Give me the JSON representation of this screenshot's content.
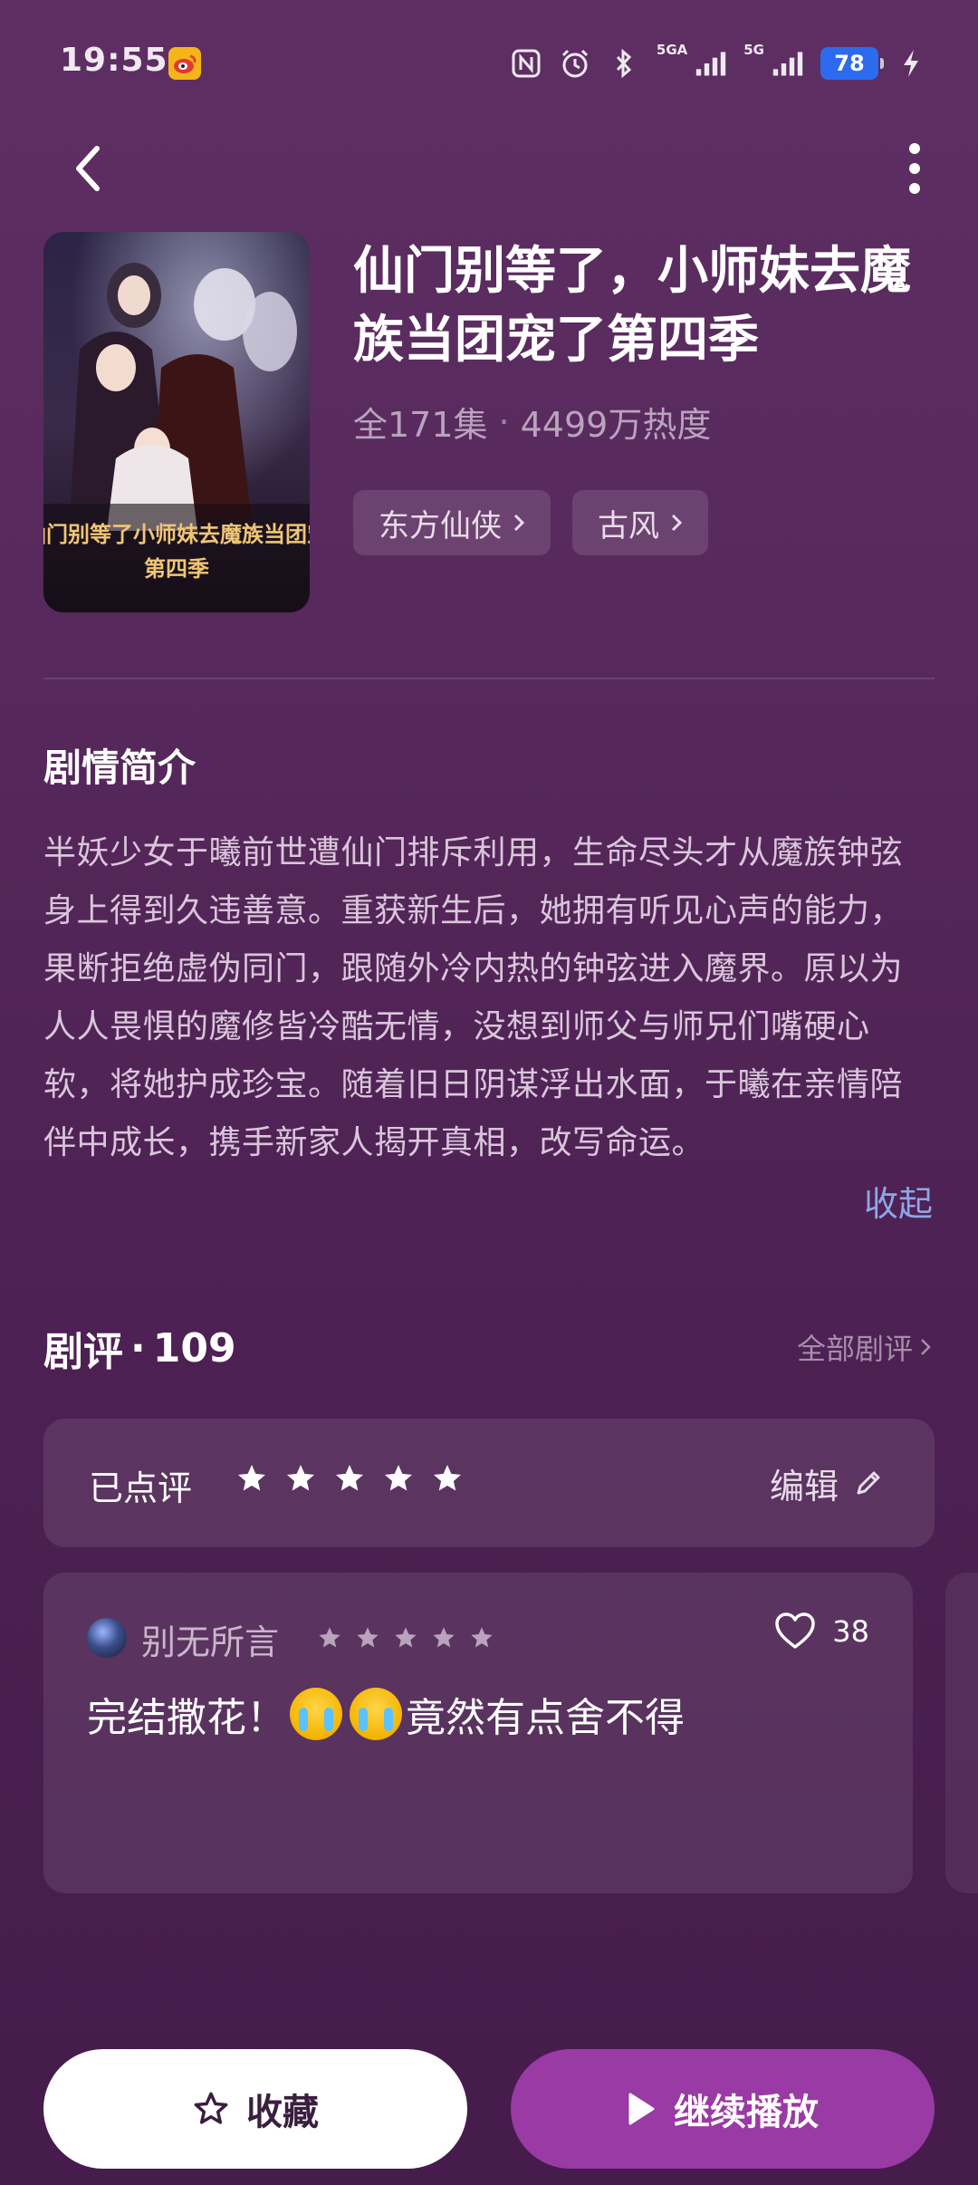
{
  "status_bar": {
    "time": "19:55",
    "network_label": "5GA",
    "network_label_2": "5G",
    "battery": "78"
  },
  "drama": {
    "title": "仙门别等了，小师妹去魔族当团宠了第四季",
    "episodes": "全171集",
    "heat": "4499万热度",
    "tags": [
      "东方仙侠",
      "古风"
    ],
    "cover_title": "仙门别等了小师妹去魔族当团宠",
    "cover_subtitle": "第四季"
  },
  "synopsis": {
    "heading": "剧情简介",
    "text": "半妖少女于曦前世遭仙门排斥利用，生命尽头才从魔族钟弦身上得到久违善意。重获新生后，她拥有听见心声的能力，果断拒绝虚伪同门，跟随外冷内热的钟弦进入魔界。原以为人人畏惧的魔修皆冷酷无情，没想到师父与师兄们嘴硬心软，将她护成珍宝。随着旧日阴谋浮出水面，于曦在亲情陪伴中成长，携手新家人揭开真相，改写命运。",
    "collapse_label": "收起"
  },
  "reviews": {
    "heading": "剧评",
    "separator": "·",
    "count": "109",
    "all_label": "全部剧评",
    "my_rating": {
      "label": "已点评",
      "stars": 5,
      "edit_label": "编辑"
    },
    "items": [
      {
        "user": "别无所言",
        "stars": 5,
        "likes": "38",
        "text_before": "完结撒花！",
        "text_after": "竟然有点舍不得"
      }
    ]
  },
  "actions": {
    "collect_label": "收藏",
    "play_label": "继续播放"
  },
  "colors": {
    "background_top": "#5e2f63",
    "background_bottom": "#451c4c",
    "accent_link": "#8fa6e6",
    "play_button": "#9a3aa4",
    "battery": "#2c6af0"
  },
  "icons": [
    "weibo-icon",
    "nfc-icon",
    "alarm-icon",
    "bluetooth-icon",
    "signal-icon",
    "battery-icon",
    "charging-icon",
    "back-icon",
    "more-icon",
    "chevron-right-icon",
    "star-icon",
    "pencil-icon",
    "heart-icon",
    "crying-emoji-icon",
    "star-outline-icon",
    "play-icon"
  ]
}
